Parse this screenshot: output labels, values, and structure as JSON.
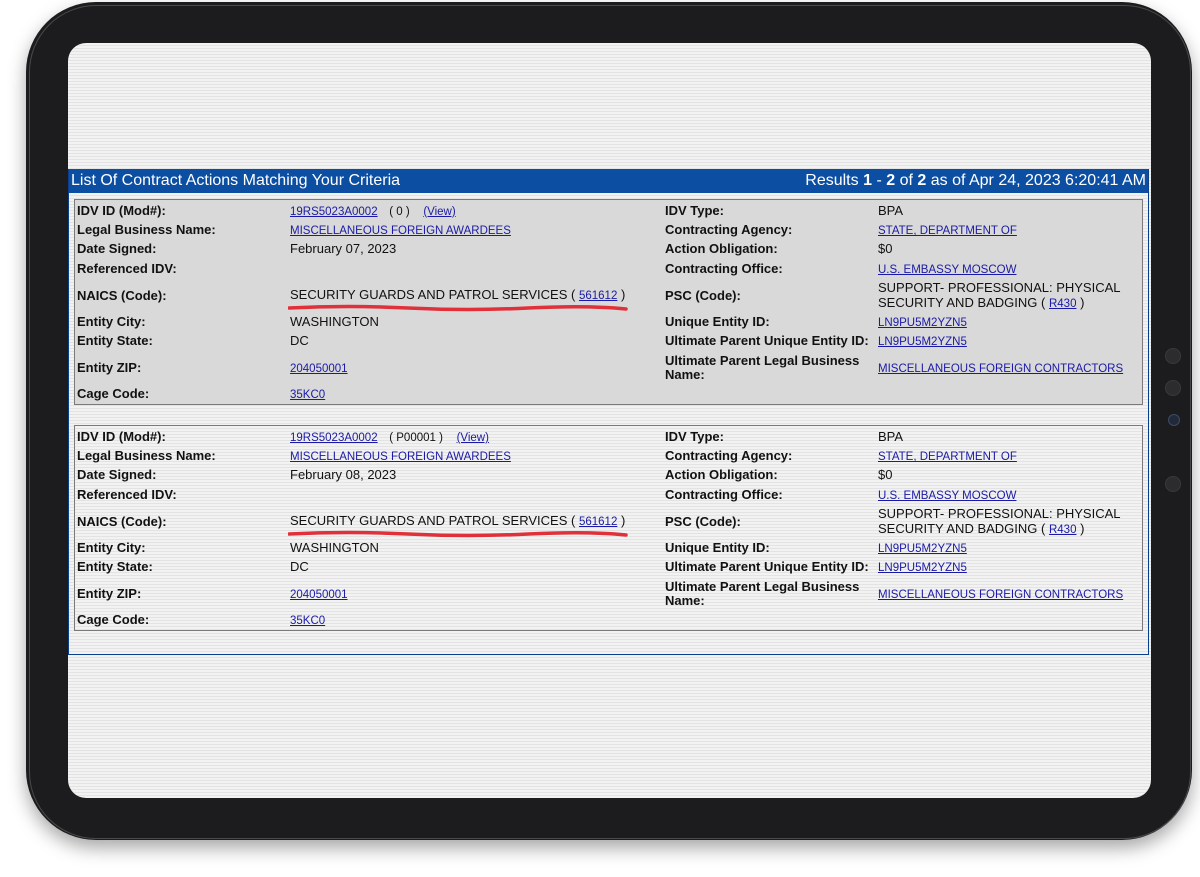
{
  "header": {
    "title": "List Of Contract Actions Matching Your Criteria",
    "results_prefix": "Results",
    "range_start": "1",
    "dash": "-",
    "range_end": "2",
    "of_word": "of",
    "total": "2",
    "as_of": "as of Apr 24, 2023 6:20:41 AM"
  },
  "labels": {
    "idv_id": "IDV ID (Mod#):",
    "legal_business_name": "Legal Business Name:",
    "date_signed": "Date Signed:",
    "referenced_idv": "Referenced IDV:",
    "naics": "NAICS (Code):",
    "entity_city": "Entity City:",
    "entity_state": "Entity State:",
    "entity_zip": "Entity ZIP:",
    "cage_code": "Cage Code:",
    "idv_type": "IDV Type:",
    "contracting_agency": "Contracting Agency:",
    "action_obligation": "Action Obligation:",
    "contracting_office": "Contracting Office:",
    "psc": "PSC (Code):",
    "unique_entity_id": "Unique Entity ID:",
    "ultimate_parent_uei": "Ultimate Parent Unique Entity ID:",
    "ultimate_parent_name_line1": "Ultimate Parent Legal Business",
    "ultimate_parent_name_line2": "Name:"
  },
  "records": [
    {
      "idv_id": "19RS5023A0002",
      "mod": "( 0 )",
      "view": "(View)",
      "legal_business_name": "MISCELLANEOUS FOREIGN AWARDEES",
      "date_signed": "February 07, 2023",
      "referenced_idv": "",
      "naics_text": "SECURITY GUARDS AND PATROL SERVICES (",
      "naics_code": "561612",
      "naics_close": ")",
      "entity_city": "WASHINGTON",
      "entity_state": "DC",
      "entity_zip": "204050001",
      "cage_code": "35KC0",
      "idv_type": "BPA",
      "contracting_agency": "STATE, DEPARTMENT OF",
      "action_obligation": "$0",
      "contracting_office": "U.S. EMBASSY MOSCOW",
      "psc_line1": "SUPPORT- PROFESSIONAL: PHYSICAL",
      "psc_line2": "SECURITY AND BADGING (",
      "psc_code": "R430",
      "psc_close": ")",
      "unique_entity_id": "LN9PU5M2YZN5",
      "ultimate_parent_uei": "LN9PU5M2YZN5",
      "ultimate_parent_name": "MISCELLANEOUS FOREIGN CONTRACTORS"
    },
    {
      "idv_id": "19RS5023A0002",
      "mod": "( P00001 )",
      "view": "(View)",
      "legal_business_name": "MISCELLANEOUS FOREIGN AWARDEES",
      "date_signed": "February 08, 2023",
      "referenced_idv": "",
      "naics_text": "SECURITY GUARDS AND PATROL SERVICES (",
      "naics_code": "561612",
      "naics_close": ")",
      "entity_city": "WASHINGTON",
      "entity_state": "DC",
      "entity_zip": "204050001",
      "cage_code": "35KC0",
      "idv_type": "BPA",
      "contracting_agency": "STATE, DEPARTMENT OF",
      "action_obligation": "$0",
      "contracting_office": "U.S. EMBASSY MOSCOW",
      "psc_line1": "SUPPORT- PROFESSIONAL: PHYSICAL",
      "psc_line2": "SECURITY AND BADGING (",
      "psc_code": "R430",
      "psc_close": ")",
      "unique_entity_id": "LN9PU5M2YZN5",
      "ultimate_parent_uei": "LN9PU5M2YZN5",
      "ultimate_parent_name": "MISCELLANEOUS FOREIGN CONTRACTORS"
    }
  ],
  "colors": {
    "header_bar": "#0b4ea2",
    "link": "#1a1aa6",
    "highlight_underline": "#e0303a"
  }
}
